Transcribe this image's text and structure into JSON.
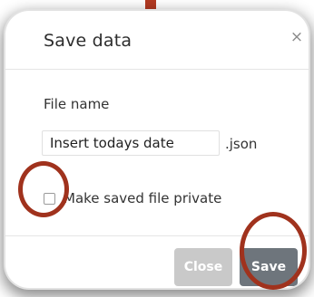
{
  "dialog": {
    "title": "Save data",
    "close_icon": "×"
  },
  "form": {
    "file_name_label": "File name",
    "file_name_value": "Insert todays date",
    "extension": ".json",
    "private_label": "Make saved file private",
    "private_checked": false
  },
  "buttons": {
    "close_label": "Close",
    "save_label": "Save"
  },
  "colors": {
    "highlight_ring": "#a0321d",
    "save_button": "#6e757c",
    "close_button": "#c9c9c9"
  },
  "icons": {
    "close": "close-icon",
    "checkbox": "checkbox-icon"
  }
}
